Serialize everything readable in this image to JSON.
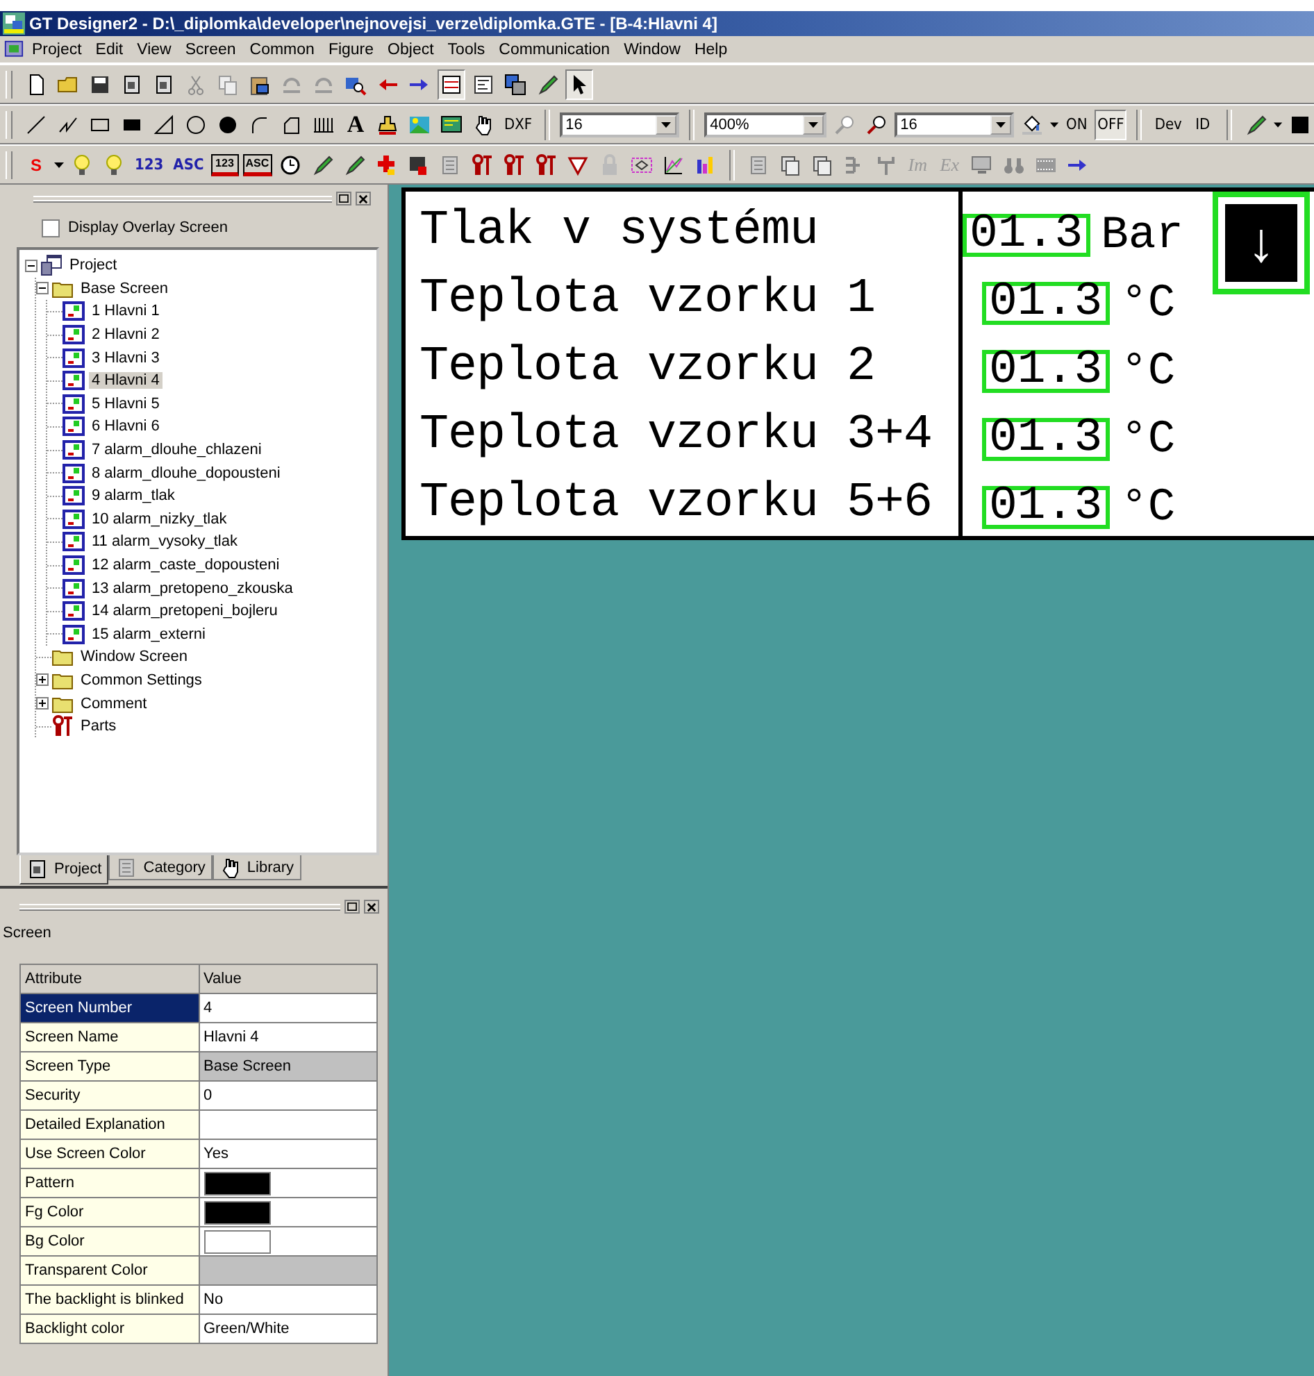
{
  "window": {
    "title": "GT Designer2 - D:\\_diplomka\\developer\\nejnovejsi_verze\\diplomka.GTE - [B-4:Hlavni 4]"
  },
  "menu": [
    "Project",
    "Edit",
    "View",
    "Screen",
    "Common",
    "Figure",
    "Object",
    "Tools",
    "Communication",
    "Window",
    "Help"
  ],
  "toolbars": [
    [
      {
        "kind": "icon",
        "pressed": false
      },
      {
        "kind": "icon",
        "pressed": false
      },
      {
        "kind": "icon",
        "pressed": false
      },
      {
        "kind": "icon",
        "pressed": false
      },
      {
        "kind": "icon",
        "pressed": false
      },
      {
        "kind": "icon",
        "pressed": false
      },
      {
        "kind": "icon",
        "pressed": false
      },
      {
        "kind": "icon",
        "pressed": false
      },
      {
        "kind": "icon",
        "pressed": false
      },
      {
        "kind": "icon",
        "pressed": false
      },
      {
        "kind": "icon",
        "pressed": false
      },
      {
        "kind": "icon",
        "pressed": false
      },
      {
        "kind": "icon",
        "pressed": false
      },
      {
        "kind": "icon",
        "pressed": true
      },
      {
        "kind": "icon",
        "pressed": false
      },
      {
        "kind": "icon",
        "pressed": false
      },
      {
        "kind": "icon",
        "pressed": false
      },
      {
        "kind": "icon",
        "pressed": true
      }
    ],
    [
      {
        "kind": "icon",
        "pressed": false
      },
      {
        "kind": "icon",
        "pressed": false
      },
      {
        "kind": "icon",
        "pressed": false
      },
      {
        "kind": "icon",
        "pressed": false
      },
      {
        "kind": "icon",
        "pressed": false
      },
      {
        "kind": "icon",
        "pressed": false
      },
      {
        "kind": "icon",
        "pressed": false
      },
      {
        "kind": "icon",
        "pressed": false
      },
      {
        "kind": "icon",
        "pressed": false
      },
      {
        "kind": "icon",
        "pressed": false
      },
      {
        "kind": "glyph",
        "label": "A"
      },
      {
        "kind": "icon",
        "pressed": false
      },
      {
        "kind": "icon",
        "pressed": false
      },
      {
        "kind": "icon",
        "pressed": false
      },
      {
        "kind": "icon",
        "pressed": false
      },
      {
        "kind": "text",
        "label": "DXF",
        "pressed": false
      },
      {
        "kind": "separator"
      },
      {
        "kind": "combo",
        "value": "16"
      },
      {
        "kind": "separator"
      },
      {
        "kind": "combo",
        "value": "400%"
      },
      {
        "kind": "icon",
        "pressed": false
      },
      {
        "kind": "icon",
        "pressed": false
      },
      {
        "kind": "combo",
        "value": "16"
      },
      {
        "kind": "icon",
        "pressed": false
      },
      {
        "kind": "caret"
      },
      {
        "kind": "text",
        "label": "ON",
        "pressed": false
      },
      {
        "kind": "text",
        "label": "OFF",
        "pressed": true
      },
      {
        "kind": "separator"
      },
      {
        "kind": "text",
        "label": "Dev",
        "pressed": false
      },
      {
        "kind": "text",
        "label": "ID",
        "pressed": false
      },
      {
        "kind": "separator"
      },
      {
        "kind": "icon",
        "pressed": false
      },
      {
        "kind": "caret"
      },
      {
        "kind": "icon",
        "pressed": false
      }
    ],
    [
      {
        "kind": "menu",
        "label": "S"
      },
      {
        "kind": "icon",
        "pressed": false
      },
      {
        "kind": "icon",
        "pressed": false
      },
      {
        "kind": "text",
        "label": "123",
        "pressed": false
      },
      {
        "kind": "text",
        "label": "ASC",
        "pressed": false
      },
      {
        "kind": "boxed",
        "label": "123"
      },
      {
        "kind": "boxed",
        "label": "ASC"
      },
      {
        "kind": "icon",
        "pressed": false
      },
      {
        "kind": "icon",
        "pressed": false
      },
      {
        "kind": "icon",
        "pressed": false
      },
      {
        "kind": "icon",
        "pressed": false
      },
      {
        "kind": "icon",
        "pressed": false
      },
      {
        "kind": "icon",
        "pressed": false
      },
      {
        "kind": "icon",
        "pressed": false
      },
      {
        "kind": "icon",
        "pressed": false
      },
      {
        "kind": "icon",
        "pressed": false
      },
      {
        "kind": "icon",
        "pressed": false
      },
      {
        "kind": "icon",
        "pressed": false
      },
      {
        "kind": "icon",
        "pressed": false
      },
      {
        "kind": "icon",
        "pressed": false
      },
      {
        "kind": "icon",
        "pressed": false
      },
      {
        "kind": "separator"
      },
      {
        "kind": "icon",
        "pressed": false
      },
      {
        "kind": "icon",
        "pressed": false
      },
      {
        "kind": "icon",
        "pressed": false
      },
      {
        "kind": "icon",
        "pressed": false
      },
      {
        "kind": "icon",
        "pressed": false
      },
      {
        "kind": "italic",
        "label": "Im"
      },
      {
        "kind": "italic",
        "label": "Ex"
      },
      {
        "kind": "icon",
        "pressed": false
      },
      {
        "kind": "icon",
        "pressed": false
      },
      {
        "kind": "icon",
        "pressed": false
      },
      {
        "kind": "icon",
        "pressed": false
      }
    ]
  ],
  "project_panel": {
    "overlay_checkbox": {
      "label": "Display Overlay Screen",
      "checked": false
    },
    "tree": [
      {
        "label": "Project",
        "kind": "project",
        "expanded": true,
        "selected": false,
        "children": [
          {
            "label": "Base Screen",
            "kind": "folder",
            "expanded": true,
            "selected": false,
            "children": [
              {
                "label": "1 Hlavni 1",
                "kind": "screen",
                "selected": false
              },
              {
                "label": "2 Hlavni 2",
                "kind": "screen",
                "selected": false
              },
              {
                "label": "3 Hlavni 3",
                "kind": "screen",
                "selected": false
              },
              {
                "label": "4 Hlavni 4",
                "kind": "screen",
                "selected": true
              },
              {
                "label": "5 Hlavni 5",
                "kind": "screen",
                "selected": false
              },
              {
                "label": "6 Hlavni 6",
                "kind": "screen",
                "selected": false
              },
              {
                "label": "7 alarm_dlouhe_chlazeni",
                "kind": "screen",
                "selected": false
              },
              {
                "label": "8 alarm_dlouhe_dopousteni",
                "kind": "screen",
                "selected": false
              },
              {
                "label": "9 alarm_tlak",
                "kind": "screen",
                "selected": false
              },
              {
                "label": "10 alarm_nizky_tlak",
                "kind": "screen",
                "selected": false
              },
              {
                "label": "11 alarm_vysoky_tlak",
                "kind": "screen",
                "selected": false
              },
              {
                "label": "12 alarm_caste_dopousteni",
                "kind": "screen",
                "selected": false
              },
              {
                "label": "13 alarm_pretopeno_zkouska",
                "kind": "screen",
                "selected": false
              },
              {
                "label": "14 alarm_pretopeni_bojleru",
                "kind": "screen",
                "selected": false
              },
              {
                "label": "15 alarm_externi",
                "kind": "screen",
                "selected": false
              }
            ]
          },
          {
            "label": "Window Screen",
            "kind": "folder",
            "selected": false
          },
          {
            "label": "Common Settings",
            "kind": "folder",
            "expanded": false,
            "selected": false
          },
          {
            "label": "Comment",
            "kind": "folder",
            "expanded": false,
            "selected": false
          },
          {
            "label": "Parts",
            "kind": "parts",
            "selected": false
          }
        ]
      }
    ],
    "tabs": [
      {
        "label": "Project",
        "selected": true
      },
      {
        "label": "Category",
        "selected": false
      },
      {
        "label": "Library",
        "selected": false
      }
    ]
  },
  "properties_panel": {
    "title": "Screen",
    "columns": [
      "Attribute",
      "Value"
    ],
    "rows": [
      {
        "attribute": "Screen Number",
        "value": "4",
        "selected": true,
        "disabled": false
      },
      {
        "attribute": "Screen Name",
        "value": "Hlavni 4",
        "selected": false,
        "disabled": false
      },
      {
        "attribute": "Screen Type",
        "value": "Base Screen",
        "selected": false,
        "disabled": true
      },
      {
        "attribute": "Security",
        "value": "0",
        "selected": false,
        "disabled": false
      },
      {
        "attribute": "Detailed Explanation",
        "selected": false,
        "disabled": false
      },
      {
        "attribute": "Use Screen Color",
        "value": "Yes",
        "selected": false,
        "disabled": false
      },
      {
        "attribute": "Pattern",
        "color": "#000000",
        "selected": false,
        "disabled": false
      },
      {
        "attribute": "Fg Color",
        "color": "#000000",
        "selected": false,
        "disabled": false
      },
      {
        "attribute": "Bg Color",
        "color": "#ffffff",
        "selected": false,
        "disabled": false
      },
      {
        "attribute": "Transparent Color",
        "selected": false,
        "disabled": true
      },
      {
        "attribute": "The backlight is blinked",
        "value": "No",
        "selected": false,
        "disabled": false
      },
      {
        "attribute": "Backlight color",
        "value": "Green/White",
        "selected": false,
        "disabled": false
      }
    ]
  },
  "screen_canvas": {
    "rows": [
      {
        "label": "Tlak v systému",
        "value": "01.3",
        "unit": "Bar"
      },
      {
        "label": "Teplota vzorku 1",
        "value": "01.3",
        "unit": "°C"
      },
      {
        "label": "Teplota vzorku 2",
        "value": "01.3",
        "unit": "°C"
      },
      {
        "label": "Teplota vzorku 3+4",
        "value": "01.3",
        "unit": "°C"
      },
      {
        "label": "Teplota vzorku 5+6",
        "value": "01.3",
        "unit": "°C"
      }
    ],
    "down_button": {
      "label": "↓"
    }
  }
}
